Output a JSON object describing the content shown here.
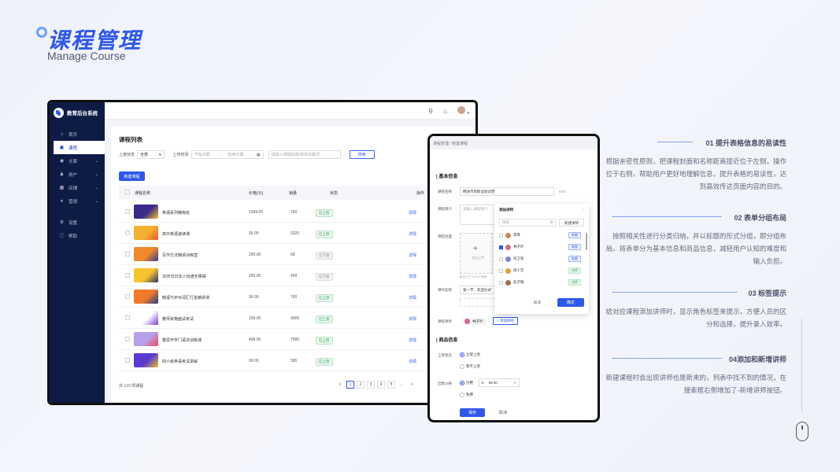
{
  "hero": {
    "title": "课程管理",
    "subtitle": "Manage Course"
  },
  "app": {
    "name": "教育后台系统"
  },
  "sidebar": {
    "items": [
      {
        "label": "首页",
        "icon": "home-icon",
        "active": false,
        "chev": false
      },
      {
        "label": "课程",
        "icon": "book-icon",
        "active": true,
        "chev": false
      },
      {
        "label": "文章",
        "icon": "article-icon",
        "active": false,
        "chev": true
      },
      {
        "label": "用户",
        "icon": "user-icon",
        "active": false,
        "chev": true
      },
      {
        "label": "店铺",
        "icon": "store-icon",
        "active": false,
        "chev": true
      },
      {
        "label": "营销",
        "icon": "tag-icon",
        "active": false,
        "chev": true
      },
      {
        "label": "设置",
        "icon": "gear-icon",
        "active": false,
        "chev": false
      },
      {
        "label": "帮助",
        "icon": "help-icon",
        "active": false,
        "chev": false
      }
    ]
  },
  "list": {
    "title": "课程列表",
    "filter": {
      "status_label": "上架状态",
      "status_value": "全部",
      "time_label": "上传时间",
      "start_ph": "开始日期",
      "sep": "~",
      "end_ph": "结束日期",
      "search_ph": "请输入课程标题/讲师关键词",
      "search_btn": "搜索"
    },
    "new_btn": "新建课程",
    "columns": {
      "name": "课程名称",
      "price": "价格(元)",
      "sales": "销量",
      "status": "状态",
      "op": "操作"
    },
    "rows": [
      {
        "name": "英语系列精练班",
        "price": "1399.00",
        "sales": "760",
        "status": "已上架",
        "up": true,
        "c1": "#3b2a8a",
        "c2": "#f2c12e"
      },
      {
        "name": "高中英语速读课",
        "price": "99.00",
        "sales": "3320",
        "status": "已上架",
        "up": true,
        "c1": "#f2b230",
        "c2": "#e85a2a"
      },
      {
        "name": "写作方法精讲训练营",
        "price": "299.00",
        "sales": "68",
        "status": "已下架",
        "up": false,
        "c1": "#f08a2a",
        "c2": "#3a3a8a"
      },
      {
        "name": "30天句日本人玩通无障碍",
        "price": "299.00",
        "sales": "459",
        "status": "已下架",
        "up": false,
        "c1": "#f4c430",
        "c2": "#2f2f6a"
      },
      {
        "name": "韩语TOPIK词汇行急精讲课",
        "price": "99.00",
        "sales": "760",
        "status": "已上架",
        "up": true,
        "c1": "#f07a2a",
        "c2": "#1e3c8a"
      },
      {
        "name": "教师资格面试考试",
        "price": "199.00",
        "sales": "3666",
        "status": "已上架",
        "up": true,
        "c1": "#ffffff",
        "c2": "#7a3ad0"
      },
      {
        "name": "雅思开学门语法训练课",
        "price": "499.00",
        "sales": "7585",
        "status": "已上架",
        "up": true,
        "c1": "#b8a0e8",
        "c2": "#e84a5a"
      },
      {
        "name": "四六级英语考试讲解",
        "price": "99.00",
        "sales": "585",
        "status": "已上架",
        "up": true,
        "c1": "#5a3ad0",
        "c2": "#f2c12e"
      }
    ],
    "detail": "详情",
    "total": "共 123 项课程",
    "pages": [
      "<",
      "1",
      "2",
      "3",
      "4",
      "5",
      "...",
      ">"
    ]
  },
  "form": {
    "breadcrumb": "课程管理 / 新建课程",
    "basic": "基本信息",
    "name_label": "课程名称",
    "name_value": "韩语币到职读陪训营",
    "name_count": "9/20",
    "intro_label": "课程简介",
    "intro_ph": "请输入课程简介",
    "cover_label": "课程封面",
    "cover_hint": "点击上传",
    "cover_note": "建议尺寸750x420像素",
    "chapter_label": "课时名称",
    "chapter_value": "第一节：欢迎仪式",
    "lecturer_label": "课程讲师",
    "lecturer_chip": "林子叶",
    "add_lecturer": "+ 添加讲师",
    "goods": "商品信息",
    "shelf_label": "上架状态",
    "shelf_opt1": "立即上架",
    "shelf_opt2": "暂不上架",
    "price_label": "出售价格",
    "price_opt1": "付费",
    "price_currency": "¥",
    "price_value": "99.00",
    "price_opt2": "免费",
    "save": "保存",
    "cancel": "取消"
  },
  "popup": {
    "title": "添加讲师",
    "search_ph": "搜索",
    "new_btn": "新建讲师",
    "people": [
      {
        "name": "李青",
        "tag": "助教",
        "checked": false,
        "t": 1,
        "c": "#c98a5a"
      },
      {
        "name": "林子叶",
        "tag": "助教",
        "checked": true,
        "t": 1,
        "c": "#d06a8a"
      },
      {
        "name": "何卫军",
        "tag": "助教",
        "checked": false,
        "t": 1,
        "c": "#7a8ad0"
      },
      {
        "name": "周小艺",
        "tag": "讲师",
        "checked": false,
        "t": 2,
        "c": "#e0a040"
      },
      {
        "name": "赵子晖",
        "tag": "讲师",
        "checked": false,
        "t": 2,
        "c": "#a07050"
      }
    ],
    "cancel": "取消",
    "ok": "确定"
  },
  "notes": [
    {
      "title": "01 提升表格信息的易读性",
      "body": "根据亲密性原则，把课程封面和名称距离接近位于左侧，操作位于右侧，帮助用户更好地理解信息，提升表格的易读性，达到高效传达页面内容的目的。"
    },
    {
      "title": "02 表单分组布局",
      "body": "按照相关性进行分类归纳，并以标题的形式分组，即分组布局。将表单分为基本信息和商品信息，减轻用户认知的难度和输入负担。"
    },
    {
      "title": "03 标签提示",
      "body": "给对应课程添加讲师时，显示角色标签来提示，方便人员的区分和选择，提升录入效率。"
    },
    {
      "title": "04添加和新增讲师",
      "body": "新建课程时会出现讲师也是新来的，列表中找不到的情况，在搜索框右侧增加了-新增讲师按钮。"
    }
  ]
}
